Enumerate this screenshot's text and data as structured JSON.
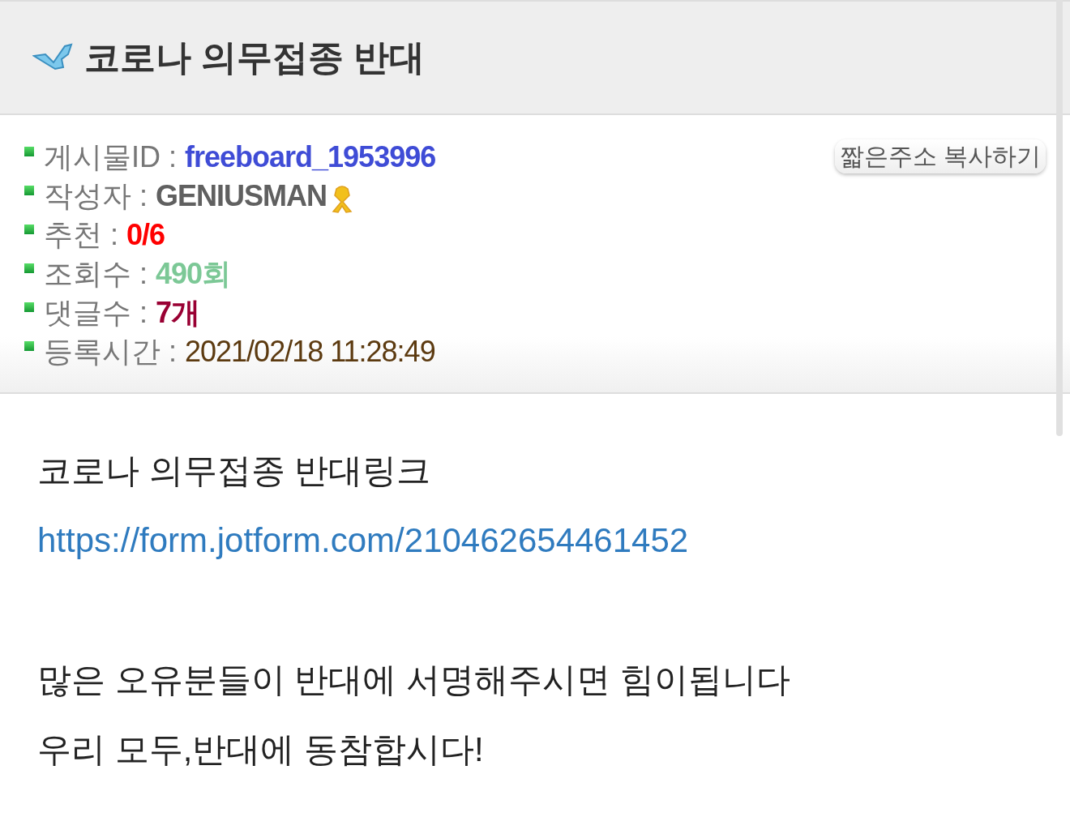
{
  "header": {
    "title": "코로나 의무접종 반대"
  },
  "meta": [
    {
      "label": "게시물ID :",
      "value": "freeboard_1953996",
      "color": "#3f4cd6"
    },
    {
      "label": "작성자 :",
      "value": "GENIUSMAN",
      "color": "#606060",
      "badge": true
    },
    {
      "label": "추천 :",
      "value": "0/6",
      "color": "#ff0000"
    },
    {
      "label": "조회수 :",
      "value": "490회",
      "color": "#7cc896"
    },
    {
      "label": "댓글수 :",
      "value": "7개",
      "color": "#990033"
    },
    {
      "label": "등록시간 :",
      "value": "2021/02/18 11:28:49",
      "color": "#5c3a10"
    }
  ],
  "copy_button": "짧은주소 복사하기",
  "body": [
    {
      "kind": "text",
      "text": "코로나 의무접종 반대링크"
    },
    {
      "kind": "link",
      "text": "https://form.jotform.com/210462654461452"
    },
    {
      "kind": "blank"
    },
    {
      "kind": "text",
      "text": "많은 오유분들이 반대에 서명해주시면 힘이됩니다"
    },
    {
      "kind": "text",
      "text": "우리 모두,반대에 동참합시다!"
    }
  ]
}
